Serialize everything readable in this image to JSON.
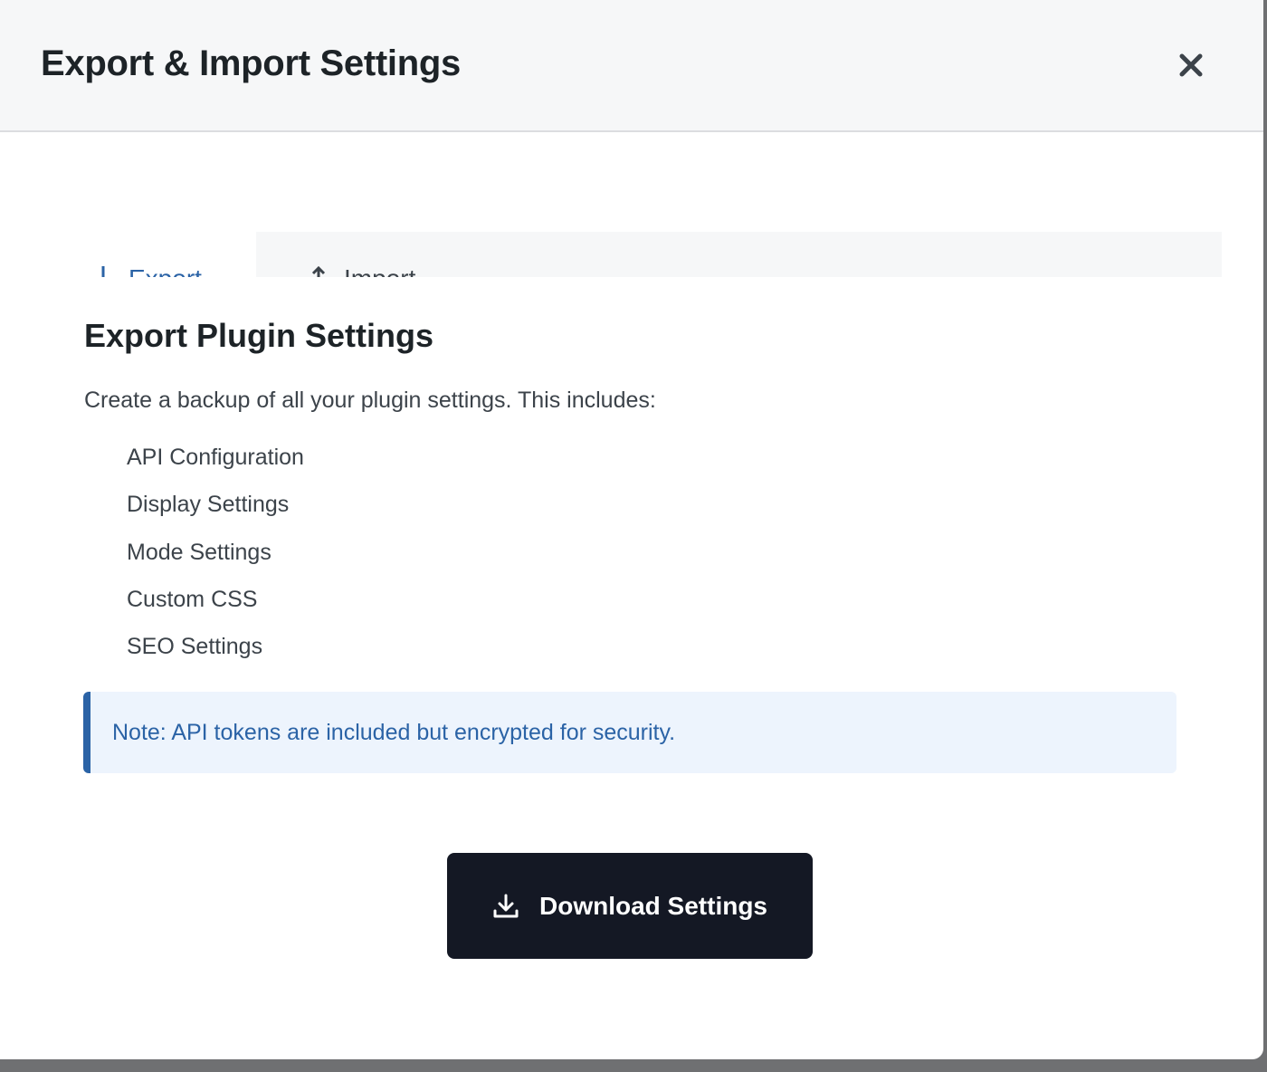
{
  "dialog": {
    "title": "Export & Import Settings"
  },
  "tabs": [
    {
      "label": "Export",
      "icon": "download-icon",
      "active": true
    },
    {
      "label": "Import",
      "icon": "upload-icon",
      "active": false
    }
  ],
  "export_panel": {
    "title": "Export Plugin Settings",
    "intro": "Create a backup of all your plugin settings. This includes:",
    "items": [
      "API Configuration",
      "Display Settings",
      "Mode Settings",
      "Custom CSS",
      "SEO Settings"
    ],
    "note": "Note: API tokens are included but encrypted for security.",
    "download_button_label": "Download Settings"
  },
  "colors": {
    "accent": "#2b63a6",
    "note_background": "#edf4fd",
    "button_background": "#141824",
    "header_background": "#f6f7f8"
  }
}
